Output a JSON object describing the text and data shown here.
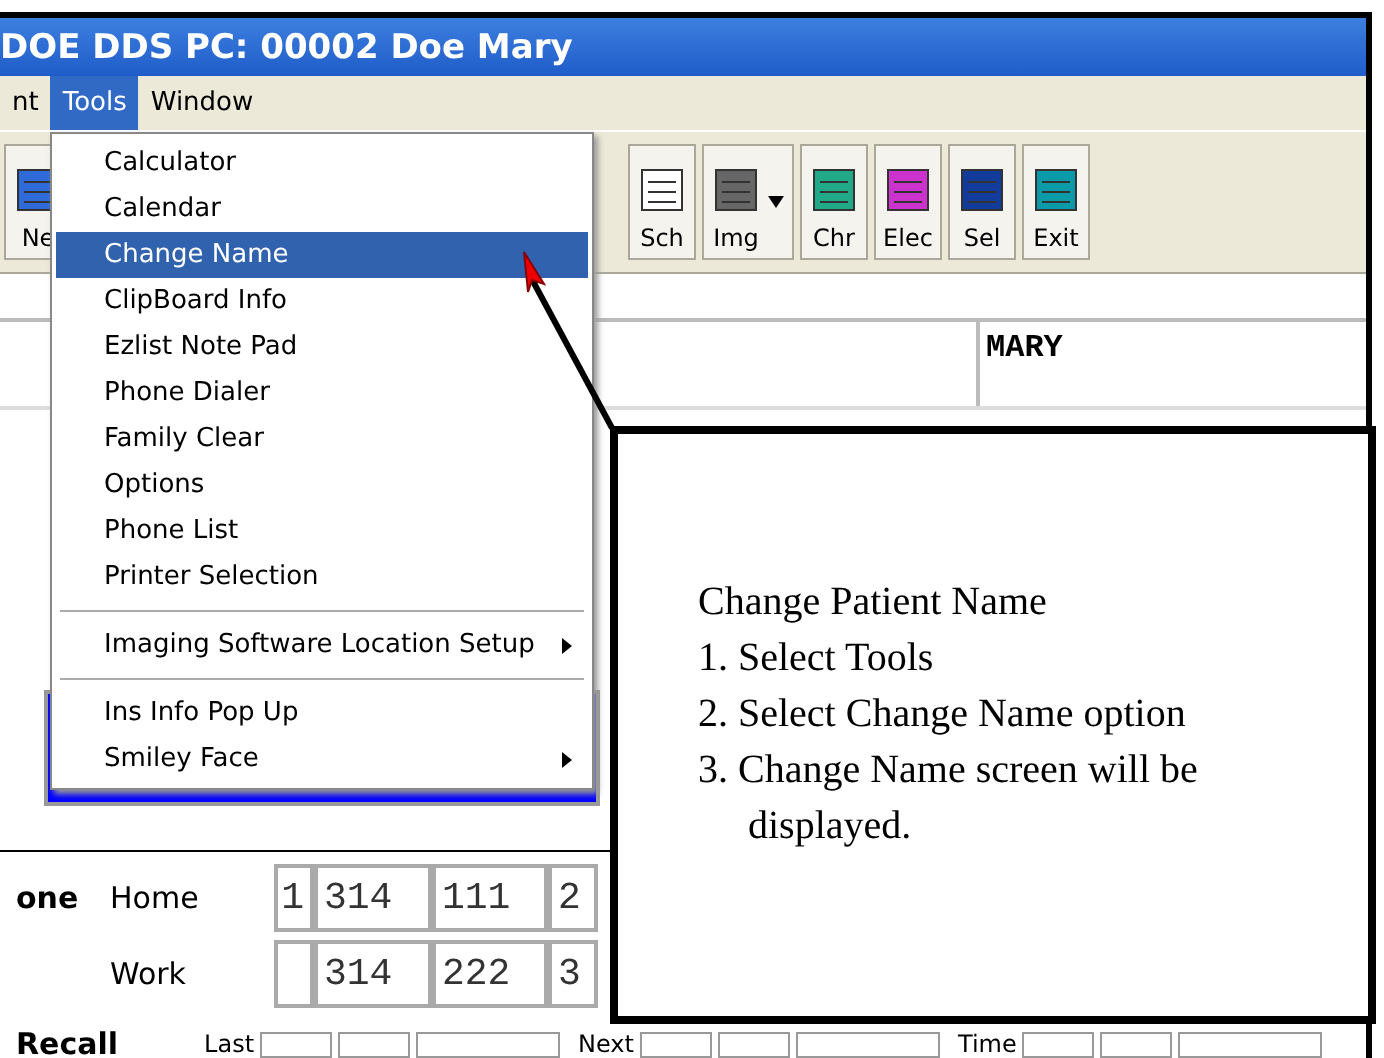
{
  "window": {
    "title": "DOE  DDS PC: 00002 Doe Mary"
  },
  "menu_bar": [
    {
      "label": "nt",
      "selected": false
    },
    {
      "label": "Tools",
      "selected": true
    },
    {
      "label": "Window",
      "selected": false
    }
  ],
  "toolbar": [
    {
      "label": "Ne",
      "dropdown": false
    },
    {
      "label": "Sch",
      "dropdown": false
    },
    {
      "label": "Img",
      "dropdown": true
    },
    {
      "label": "Chr",
      "dropdown": false
    },
    {
      "label": "Elec",
      "dropdown": false
    },
    {
      "label": "Sel",
      "dropdown": false
    },
    {
      "label": "Exit",
      "dropdown": false
    }
  ],
  "tools_menu": {
    "items": [
      {
        "kind": "item",
        "label": "Calculator",
        "selected": false,
        "submenu": false
      },
      {
        "kind": "item",
        "label": "Calendar",
        "selected": false,
        "submenu": false
      },
      {
        "kind": "item",
        "label": "Change Name",
        "selected": true,
        "submenu": false
      },
      {
        "kind": "item",
        "label": "ClipBoard Info",
        "selected": false,
        "submenu": false
      },
      {
        "kind": "item",
        "label": "Ezlist Note Pad",
        "selected": false,
        "submenu": false
      },
      {
        "kind": "item",
        "label": "Phone Dialer",
        "selected": false,
        "submenu": false
      },
      {
        "kind": "item",
        "label": "Family Clear",
        "selected": false,
        "submenu": false
      },
      {
        "kind": "item",
        "label": "Options",
        "selected": false,
        "submenu": false
      },
      {
        "kind": "item",
        "label": "Phone List",
        "selected": false,
        "submenu": false
      },
      {
        "kind": "item",
        "label": "Printer Selection",
        "selected": false,
        "submenu": false
      },
      {
        "kind": "separator"
      },
      {
        "kind": "item",
        "label": "Imaging Software Location Setup",
        "selected": false,
        "submenu": true
      },
      {
        "kind": "separator"
      },
      {
        "kind": "item",
        "label": "Ins Info Pop Up",
        "selected": false,
        "submenu": false
      },
      {
        "kind": "item",
        "label": "Smiley Face",
        "selected": false,
        "submenu": true
      }
    ]
  },
  "patient": {
    "first_name": "MARY"
  },
  "phone": {
    "heading": "one",
    "rows": [
      {
        "label": "Home",
        "ext": "1",
        "area": "314",
        "prefix": "111",
        "line": "2"
      },
      {
        "label": "Work",
        "area": "314",
        "prefix": "222",
        "line": "3"
      }
    ]
  },
  "recall": {
    "heading": "Recall",
    "labels": [
      "Last",
      "Next",
      "Time"
    ]
  },
  "callout": {
    "title": "Change Patient Name",
    "steps": [
      "1. Select Tools",
      "2. Select Change Name option",
      "3. Change Name screen will be displayed."
    ]
  }
}
